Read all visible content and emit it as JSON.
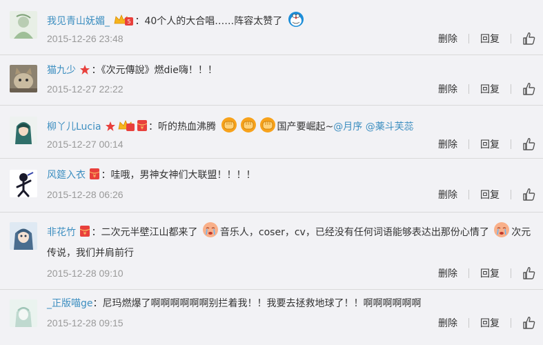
{
  "comments": [
    {
      "username": "我见青山妩媚_",
      "parts": {
        "a": "40个人的大合唱……阵容太赞了"
      },
      "time": "2015-12-26 23:48"
    },
    {
      "username": "猫九少",
      "parts": {
        "a": "《次元傳說》燃die嗨！！！"
      },
      "time": "2015-12-27 22:22"
    },
    {
      "username": "柳丫儿Lucia",
      "parts": {
        "a": "听的热血沸腾",
        "b": "国产要崛起~",
        "m1": "@月序",
        "m2": "@薬斗芙蕊"
      },
      "time": "2015-12-27 00:14"
    },
    {
      "username": "风筵入衣",
      "parts": {
        "a": "哇哦，男神女神们大联盟！！！！"
      },
      "time": "2015-12-28 06:26"
    },
    {
      "username": "非花竹",
      "parts": {
        "a": "二次元半壁江山都来了",
        "b": "音乐人，coser，cv，已经没有任何词语能够表达出那份心情了",
        "c": "次元传说，我们并肩前行"
      },
      "time": "2015-12-28 09:10"
    },
    {
      "username": "_正版喵ge",
      "parts": {
        "a": "尼玛燃爆了啊啊啊啊啊啊别拦着我！！我要去拯救地球了！！啊啊啊啊啊啊"
      },
      "time": "2015-12-28 09:15"
    }
  ],
  "labels": {
    "delete": "删除",
    "reply": "回复",
    "colon": "："
  },
  "icons": {
    "like": "thumbs-up-icon",
    "vip": "crown-vip-icon",
    "redpacket": "red-envelope-icon",
    "star": "red-star-icon",
    "doraemon": "doraemon-emoticon",
    "fist": "fist-emoticon",
    "crying": "crying-face-emoticon"
  },
  "colors": {
    "link": "#3c8ec0",
    "meta": "#999999",
    "text": "#333333",
    "background": "#f2f2f5",
    "divider": "#d9d9d9",
    "badge_red": "#e8403c"
  }
}
